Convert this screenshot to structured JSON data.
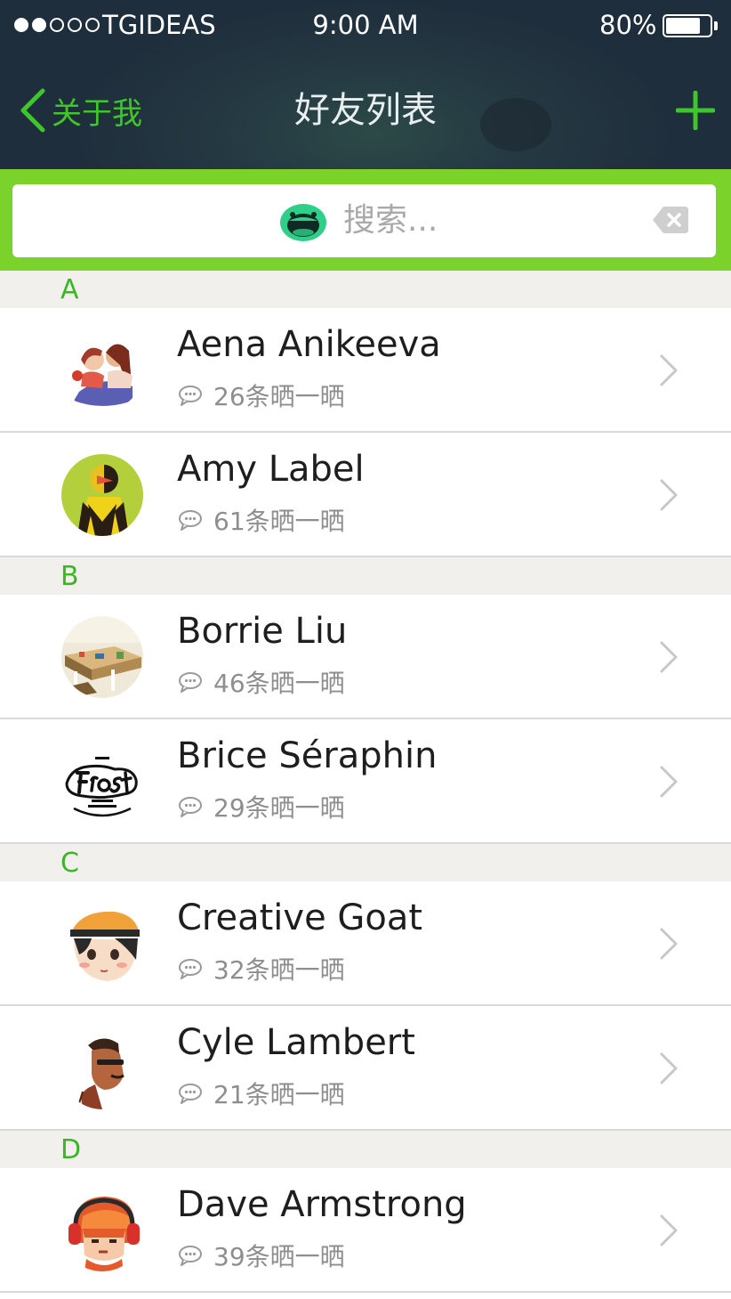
{
  "status_bar": {
    "carrier": "TGIDEAS",
    "time": "9:00 AM",
    "battery": "80%",
    "battery_level": 0.8,
    "signal_bars_filled": 2,
    "signal_bars_total": 5
  },
  "nav": {
    "back_label": "关于我",
    "title": "好友列表"
  },
  "search": {
    "placeholder": "搜索..."
  },
  "colors": {
    "accent_green": "#3fc62a",
    "search_band": "#7bd22b",
    "header_dark": "#1f2e3c"
  },
  "sections": [
    {
      "letter": "A",
      "friends": [
        {
          "name": "Aena Anikeeva",
          "posts": "26条晒一晒",
          "avatar": "illustrated-couple-avatar"
        },
        {
          "name": "Amy Label",
          "posts": "61条晒一晒",
          "avatar": "yellow-geometric-avatar"
        }
      ]
    },
    {
      "letter": "B",
      "friends": [
        {
          "name": "Borrie Liu",
          "posts": "46条晒一晒",
          "avatar": "workspace-illustration-avatar"
        },
        {
          "name": "Brice Séraphin",
          "posts": "29条晒一晒",
          "avatar": "frost-logo-avatar"
        }
      ]
    },
    {
      "letter": "C",
      "friends": [
        {
          "name": "Creative Goat",
          "posts": "32条晒一晒",
          "avatar": "boy-with-hat-avatar"
        },
        {
          "name": "Cyle Lambert",
          "posts": "21条晒一晒",
          "avatar": "man-portrait-avatar"
        }
      ]
    },
    {
      "letter": "D",
      "friends": [
        {
          "name": "Dave Armstrong",
          "posts": "39条晒一晒",
          "avatar": "headphones-character-avatar"
        }
      ]
    }
  ]
}
